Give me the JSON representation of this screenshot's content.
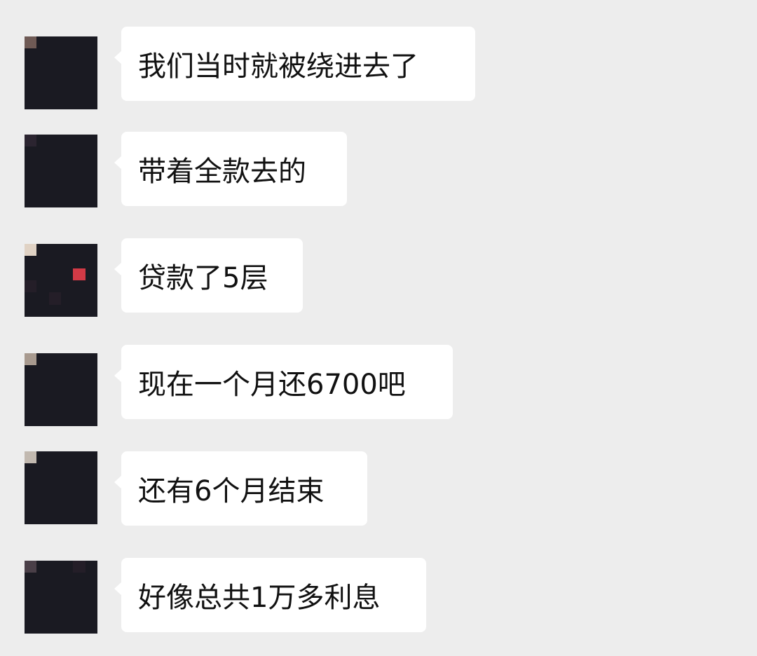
{
  "colors": {
    "background": "#ededed",
    "bubble": "#ffffff",
    "text": "#111111"
  },
  "messages": [
    {
      "text": "我们当时就被绕进去了"
    },
    {
      "text": "带着全款去的"
    },
    {
      "text": "贷款了5层"
    },
    {
      "text": "现在一个月还6700吧"
    },
    {
      "text": "还有6个月结束"
    },
    {
      "text": "好像总共1万多利息"
    }
  ],
  "avatar_palette": [
    "#1a1a22",
    "#2b2430",
    "#c2b9b0",
    "#8b1a22",
    "#d8c7b8",
    "#3a3340",
    "#6f5a55",
    "#a89a8f",
    "#241e28",
    "#d23a46",
    "#b8c0cc",
    "#9a8470",
    "#e0d2c4",
    "#4a3f48",
    "#151318",
    "#c8a58a"
  ]
}
